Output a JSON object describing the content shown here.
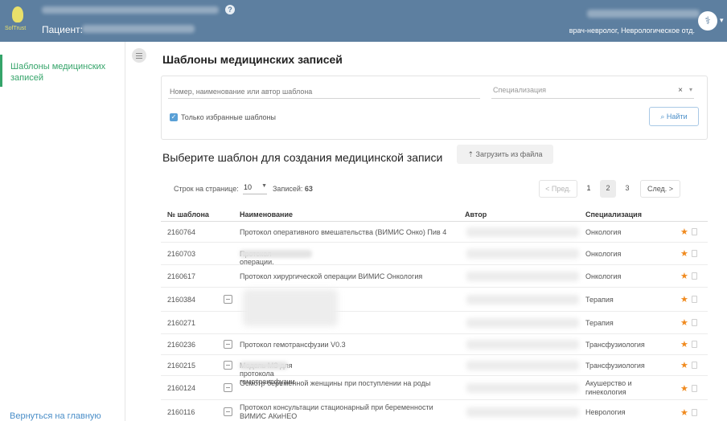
{
  "header": {
    "brand": "SofTrust",
    "patient_label": "Пациент:",
    "doctor_role": "врач-невролог, Неврологическое отд."
  },
  "sidebar": {
    "active_item": "Шаблоны медицинских записей",
    "bottom_link": "Вернуться на главную"
  },
  "page": {
    "title": "Шаблоны медицинских записей"
  },
  "search": {
    "name_placeholder": "Номер, наименование или автор шаблона",
    "spec_placeholder": "Специализация",
    "clear": "×",
    "favorites_label": "Только избранные шаблоны",
    "favorites_checked": true,
    "find_button": "Найти"
  },
  "section": {
    "title": "Выберите шаблон для создания медицинской записи",
    "upload_button": "Загрузить из файла"
  },
  "paging": {
    "rows_label": "Строк на странице:",
    "rows_value": "10",
    "records_label": "Записей:",
    "records_value": "63",
    "prev": "< Пред.",
    "pages": [
      "1",
      "2",
      "3"
    ],
    "next": "След. >"
  },
  "table": {
    "headers": [
      "№ шаблона",
      "Наименование",
      "Автор",
      "Специализация"
    ],
    "rows": [
      {
        "id": "2160764",
        "name": "Протокол оперативного вмешательства (ВИМИС Онко) Пив 4",
        "spec": "Онкология"
      },
      {
        "id": "2160703",
        "name": "Протокол операции.",
        "spec": "Онкология"
      },
      {
        "id": "2160617",
        "name": "Протокол хирургической операции ВИМИС Онкология",
        "spec": "Онкология"
      },
      {
        "id": "2160384",
        "name": "",
        "spec": "Терапия"
      },
      {
        "id": "2160271",
        "name": "",
        "spec": "Терапия"
      },
      {
        "id": "2160236",
        "name": "Протокол гемотрансфузии V0.3",
        "spec": "Трансфузиология"
      },
      {
        "id": "2160215",
        "name": "Модель МЗ для протокола гемотрансфузии",
        "spec": "Трансфузиология"
      },
      {
        "id": "2160124",
        "name": "Осмотр беременной женщины при поступлении на роды",
        "spec": "Акушерство и гинекология"
      },
      {
        "id": "2160116",
        "name": "Протокол консультации стационарный при беременности ВИМИС АКиНЕО",
        "spec": "Неврология"
      }
    ]
  },
  "colors": {
    "header_bg": "#5d7fa0",
    "accent_green": "#35a46a",
    "link_blue": "#4a8ec8",
    "star_orange": "#f08a1e"
  }
}
